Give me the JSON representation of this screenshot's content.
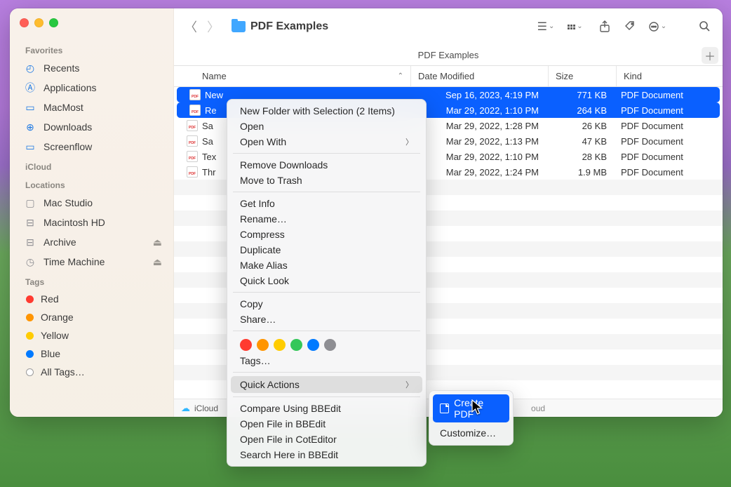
{
  "window": {
    "title": "PDF Examples",
    "tab_title": "PDF Examples"
  },
  "sidebar": {
    "sections": {
      "favorites_label": "Favorites",
      "icloud_label": "iCloud",
      "locations_label": "Locations",
      "tags_label": "Tags"
    },
    "favorites": [
      {
        "label": "Recents",
        "icon": "clock-icon"
      },
      {
        "label": "Applications",
        "icon": "apps-icon"
      },
      {
        "label": "MacMost",
        "icon": "folder-icon"
      },
      {
        "label": "Downloads",
        "icon": "download-icon"
      },
      {
        "label": "Screenflow",
        "icon": "folder-icon"
      }
    ],
    "locations": [
      {
        "label": "Mac Studio",
        "icon": "computer-icon",
        "eject": false
      },
      {
        "label": "Macintosh HD",
        "icon": "disk-icon",
        "eject": false
      },
      {
        "label": "Archive",
        "icon": "disk-icon",
        "eject": true
      },
      {
        "label": "Time Machine",
        "icon": "timemachine-icon",
        "eject": true
      }
    ],
    "tags": [
      {
        "label": "Red",
        "color": "#ff3b30"
      },
      {
        "label": "Orange",
        "color": "#ff9500"
      },
      {
        "label": "Yellow",
        "color": "#ffcc00"
      },
      {
        "label": "Blue",
        "color": "#007aff"
      },
      {
        "label": "All Tags…",
        "color": null
      }
    ]
  },
  "columns": {
    "name": "Name",
    "date": "Date Modified",
    "size": "Size",
    "kind": "Kind"
  },
  "files": [
    {
      "name": "New",
      "date": "Sep 16, 2023, 4:19 PM",
      "size": "771 KB",
      "kind": "PDF Document",
      "selected": true
    },
    {
      "name": "Re",
      "date": "Mar 29, 2022, 1:10 PM",
      "size": "264 KB",
      "kind": "PDF Document",
      "selected": true
    },
    {
      "name": "Sa",
      "date": "Mar 29, 2022, 1:28 PM",
      "size": "26 KB",
      "kind": "PDF Document",
      "selected": false
    },
    {
      "name": "Sa",
      "date": "Mar 29, 2022, 1:13 PM",
      "size": "47 KB",
      "kind": "PDF Document",
      "selected": false
    },
    {
      "name": "Tex",
      "date": "Mar 29, 2022, 1:10 PM",
      "size": "28 KB",
      "kind": "PDF Document",
      "selected": false
    },
    {
      "name": "Thr",
      "date": "Mar 29, 2022, 1:24 PM",
      "size": "1.9 MB",
      "kind": "PDF Document",
      "selected": false
    }
  ],
  "pathbar": {
    "label": "iCloud",
    "trail": "oud"
  },
  "context_menu": {
    "items": [
      {
        "label": "New Folder with Selection (2 Items)"
      },
      {
        "label": "Open"
      },
      {
        "label": "Open With",
        "submenu": true
      }
    ],
    "group2": [
      {
        "label": "Remove Downloads"
      },
      {
        "label": "Move to Trash"
      }
    ],
    "group3": [
      {
        "label": "Get Info"
      },
      {
        "label": "Rename…"
      },
      {
        "label": "Compress"
      },
      {
        "label": "Duplicate"
      },
      {
        "label": "Make Alias"
      },
      {
        "label": "Quick Look"
      }
    ],
    "group4": [
      {
        "label": "Copy"
      },
      {
        "label": "Share…"
      }
    ],
    "tag_colors": [
      "#ff3b30",
      "#ff9500",
      "#ffcc00",
      "#34c759",
      "#007aff",
      "#8e8e93"
    ],
    "tags_label": "Tags…",
    "quick_actions_label": "Quick Actions",
    "group5": [
      {
        "label": "Compare Using BBEdit"
      },
      {
        "label": "Open File in BBEdit"
      },
      {
        "label": "Open File in CotEditor"
      },
      {
        "label": "Search Here in BBEdit"
      }
    ]
  },
  "submenu": {
    "create_pdf": "Create PDF",
    "customize": "Customize…"
  }
}
